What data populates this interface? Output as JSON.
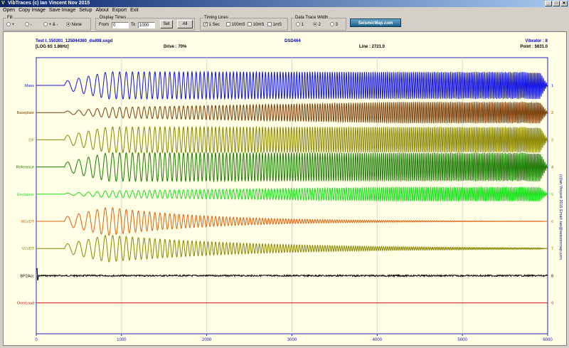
{
  "window": {
    "title": "VibTraces (c) Ian Vincent Nov 2015",
    "buttons": [
      "_",
      "□",
      "✕"
    ]
  },
  "menu": [
    "Open",
    "Copy Image",
    "Save Image",
    "Setup",
    "About",
    "Export",
    "Exit"
  ],
  "fill": {
    "title": "Fill",
    "options": [
      "+",
      "-",
      "+ & -",
      "None"
    ],
    "selected": 3
  },
  "display_times": {
    "title": "Display Times",
    "from_label": "From",
    "from_value": "0",
    "to_label": "To",
    "to_value": "1000",
    "set_label": "Set",
    "all_label": "All"
  },
  "timing_lines": {
    "title": "Timing Lines",
    "options": [
      "1 Sec",
      "100mS",
      "10mS",
      "1mS"
    ],
    "checked": [
      true,
      false,
      false,
      false
    ]
  },
  "data_trace_width": {
    "title": "Data Trace Width",
    "options": [
      "1",
      "2",
      "3"
    ],
    "selected": 1
  },
  "logo_text": "SeismicMap.com",
  "plot_header": {
    "file": "Test I. 150201_125044360_dsd08.sxgd",
    "log": "[LOG 6S 1.86Hz]",
    "drive": "Drive : 70%",
    "device": "DSD464",
    "line": "Line : 2721.0",
    "vibrator": "Vibrator : 8",
    "point": "Point : 5631.0"
  },
  "credit_text": "(c)Ian Vincent 2015  Email: ian@seismicmap.com",
  "colors": {
    "Mass": "#1010e0",
    "Baseplate": "#7a3d08",
    "GF": "#8a8500",
    "Reference": "#1a7a00",
    "Excitation": "#18e018",
    "MLVDT": "#e06010",
    "VLVDT": "#8a8500",
    "BP2Acc": "#000000",
    "OverLoad": "#e01010"
  },
  "chart_data": {
    "type": "line",
    "xlim": [
      0,
      6000
    ],
    "x_ticks": [
      0,
      1000,
      2000,
      3000,
      4000,
      5000,
      6000
    ],
    "x_tick_labels": [
      "0",
      "1000",
      "2000",
      "3000",
      "4000",
      "5000",
      "6000"
    ],
    "traces": [
      {
        "name": "Mass",
        "number": "1",
        "kind": "sweep",
        "amp": 0.95,
        "decay": 0
      },
      {
        "name": "Baseplate",
        "number": "2",
        "kind": "sweep",
        "amp": 0.75,
        "decay": -0.5
      },
      {
        "name": "GF",
        "number": "3",
        "kind": "sweep",
        "amp": 0.9,
        "decay": 0
      },
      {
        "name": "Reference",
        "number": "4",
        "kind": "sweep",
        "amp": 1.0,
        "decay": 0
      },
      {
        "name": "Excitation",
        "number": "5",
        "kind": "sweep",
        "amp": 0.5,
        "decay": -0.4
      },
      {
        "name": "MLVDT",
        "number": "6",
        "kind": "sweep",
        "amp": 1.0,
        "decay": 1.0
      },
      {
        "name": "VLVDT",
        "number": "7",
        "kind": "sweep",
        "amp": 0.95,
        "decay": 0.7
      },
      {
        "name": "BP2Acc",
        "number": "8",
        "kind": "noise",
        "amp": 0.1,
        "decay": 0
      },
      {
        "name": "OverLoad",
        "number": "9",
        "kind": "flat",
        "amp": 0,
        "decay": 0
      }
    ]
  }
}
